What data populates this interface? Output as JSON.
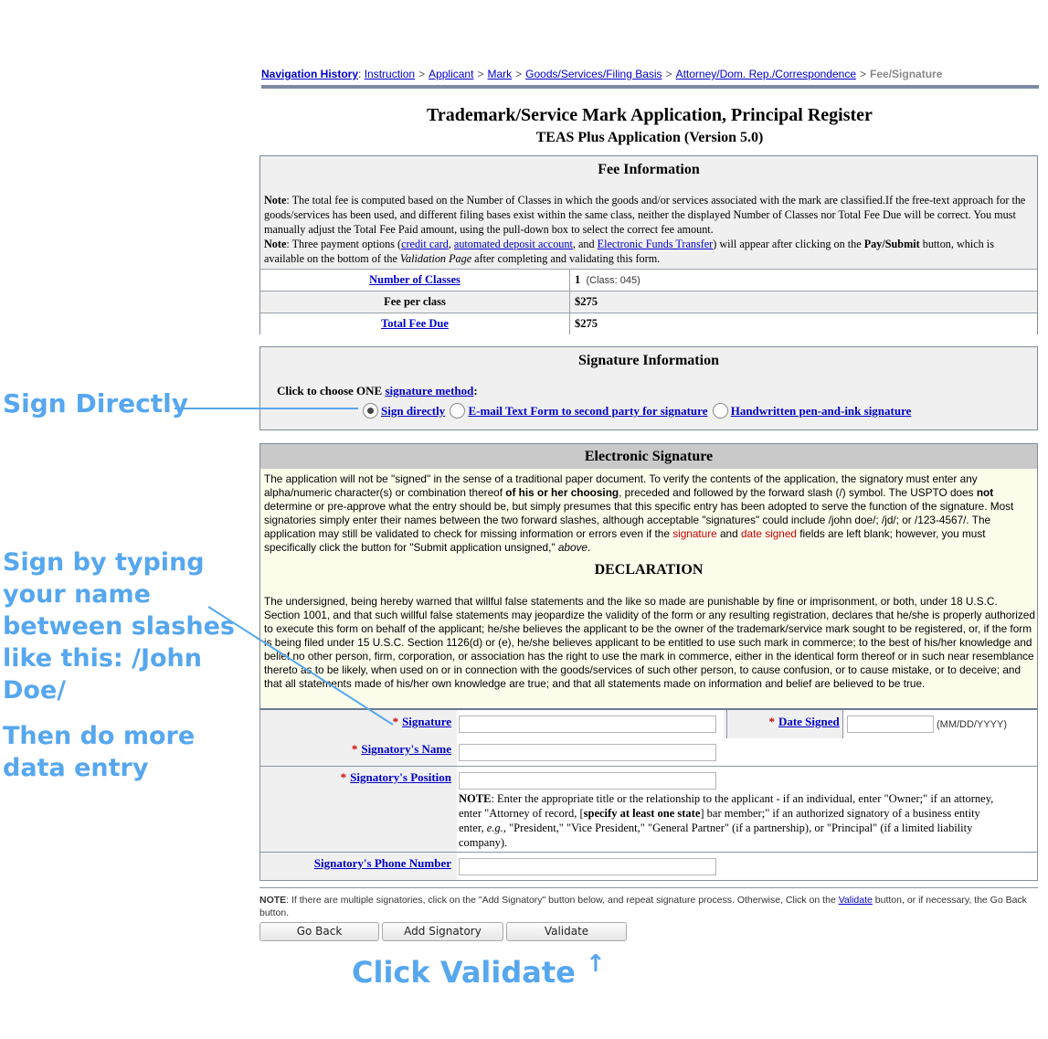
{
  "nav": {
    "head": "Navigation History",
    "items": [
      "Instruction",
      "Applicant",
      "Mark",
      "Goods/Services/Filing Basis",
      "Attorney/Dom. Rep./Correspondence"
    ],
    "current": "Fee/Signature"
  },
  "title": "Trademark/Service Mark Application, Principal Register",
  "subtitle": "TEAS Plus Application (Version 5.0)",
  "fee": {
    "heading": "Fee Information",
    "note1_label": "Note",
    "note1_text": ": The total fee is computed based on the Number of Classes in which the goods and/or services associated with the mark are classified.If the free-text approach for the goods/services has been used, and different filing bases exist within the same class, neither the displayed Number of Classes nor Total Fee Due will be correct. You must manually adjust the Total Fee Paid amount, using the pull-down box to select the correct fee amount.",
    "note2_label": "Note",
    "note2_a": ": Three payment options (",
    "link_credit": "credit card",
    "link_deposit": "automated deposit account",
    "note2_b": ", and ",
    "link_eft": "Electronic Funds Transfer",
    "note2_c": ") will appear after clicking on the ",
    "pay_submit": "Pay/Submit",
    "note2_d": " button, which is available on the bottom of the ",
    "validation_page": "Validation Page",
    "note2_e": " after completing and validating this form.",
    "rows": {
      "classes_label": "Number of Classes",
      "classes_value": "1",
      "classes_detail": "(Class: 045)",
      "per_class_label": "Fee per class",
      "per_class_value": "$275",
      "total_label": "Total Fee Due",
      "total_value": "$275"
    }
  },
  "signature_info": {
    "heading": "Signature Information",
    "prompt": "Click to choose ONE ",
    "prompt_link": "signature method",
    "prompt_end": ":",
    "option_direct": "Sign directly",
    "option_email": "E-mail Text Form to second party for signature",
    "option_handwritten": "Handwritten pen-and-ink signature"
  },
  "esig": {
    "heading": "Electronic Signature",
    "p1_a": "The application will not be \"signed\" in the sense of a traditional paper document. To verify the contents of the application, the signatory must enter any alpha/numeric character(s) or combination thereof ",
    "p1_bold": "of his or her choosing",
    "p1_b": ", preceded and followed by the forward slash (/) symbol. The USPTO does ",
    "p1_not": "not",
    "p1_c": " determine or pre-approve what the entry should be, but simply presumes that this specific entry has been adopted to serve the function of the signature. Most signatories simply enter their names between the two forward slashes, although acceptable \"signatures\" could include /john doe/; /jd/; or /123-4567/. The application may still be validated to check for missing information or errors even if the ",
    "p1_red1": "signature",
    "p1_and": " and ",
    "p1_red2": "date signed",
    "p1_d": " fields are left blank; however, you must specifically click the button for \"Submit application unsigned,\" ",
    "p1_above": "above",
    "p1_end": ".",
    "decl_heading": "DECLARATION",
    "decl_text": "The undersigned, being hereby warned that willful false statements and the like so made are punishable by fine or imprisonment, or both, under 18 U.S.C. Section 1001, and that such willful false statements may jeopardize the validity of the form or any resulting registration, declares that he/she is properly authorized to execute this form on behalf of the applicant; he/she believes the applicant to be the owner of the trademark/service mark sought to be registered, or, if the form is being filed under 15 U.S.C. Section 1126(d) or (e), he/she believes applicant to be entitled to use such mark in commerce; to the best of his/her knowledge and belief no other person, firm, corporation, or association has the right to use the mark in commerce, either in the identical form thereof or in such near resemblance thereto as to be likely, when used on or in connection with the goods/services of such other person, to cause confusion, or to cause mistake, or to deceive; and that all statements made of his/her own knowledge are true; and that all statements made on information and belief are believed to be true."
  },
  "fields": {
    "req_mark": "*",
    "signature_label": "Signature",
    "signature_value": "",
    "date_label": "Date Signed",
    "date_value": "",
    "date_hint": "(MM/DD/YYYY)",
    "name_label": "Signatory's Name",
    "name_value": "",
    "position_label": "Signatory's Position",
    "position_value": "",
    "position_note_label": "NOTE",
    "position_note_a": ": Enter the appropriate title or the relationship to the applicant - if an individual, enter \"Owner;\" if an attorney, enter \"Attorney of record, [",
    "position_note_bold": "specify at least one state",
    "position_note_b": "] bar member;\" if an authorized signatory of a business entity enter, ",
    "position_note_eg": "e.g.",
    "position_note_c": ", \"President,\" \"Vice President,\" \"General Partner\" (if a partnership), or \"Principal\" (if a limited liability company).",
    "phone_label": "Signatory's Phone Number",
    "phone_value": ""
  },
  "bottom": {
    "note_label": "NOTE",
    "note_a": ": If there are multiple signatories, click on the \"Add Signatory\" button below, and repeat signature process. Otherwise, Click on the ",
    "note_link": "Validate",
    "note_b": " button, or if necessary, the Go Back button.",
    "btn_back": "Go Back",
    "btn_add": "Add Signatory",
    "btn_validate": "Validate"
  },
  "annotations": {
    "sign_directly": "Sign Directly",
    "type_name": "Sign by typing your name between slashes like this: /John Doe/",
    "more_entry": "Then do more data entry",
    "click_validate": "Click Validate",
    "arrow_glyph": "↑",
    "color": "#56a7ee"
  },
  "colors": {
    "link": "#0000cc",
    "required": "#cc0000",
    "panel_bg": "#f0f0f0",
    "declaration_bg": "#fdfdec",
    "header_bg": "#c9c9c9"
  }
}
